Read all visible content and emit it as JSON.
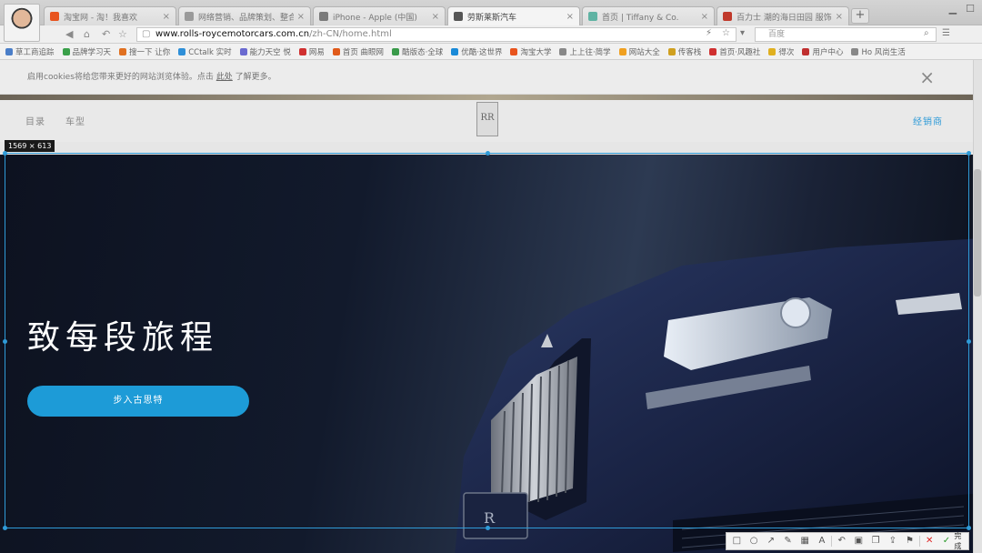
{
  "browser": {
    "tabs": [
      {
        "label": "淘宝网 - 淘！我喜欢",
        "color": "#e8541e",
        "active": false
      },
      {
        "label": "网络营销、品牌策划、整合营销",
        "color": "#9a9a9a",
        "active": false
      },
      {
        "label": "iPhone - Apple (中国)",
        "color": "#7a7a7a",
        "active": false
      },
      {
        "label": "劳斯莱斯汽车",
        "color": "#555555",
        "active": true
      },
      {
        "label": "首页 | Tiffany & Co.",
        "color": "#5fb3a3",
        "active": false
      },
      {
        "label": "百力士 潮的海日田园 服饰",
        "color": "#c0392b",
        "active": false
      }
    ],
    "tab_close": "×",
    "new_tab": "+",
    "url_host": "www.rolls-roycemotorcars.com.cn",
    "url_path": "/zh-CN/home.html",
    "search_placeholder": "百度"
  },
  "bookmarks": [
    {
      "label": "草工商追踪",
      "color": "#4a7ec8"
    },
    {
      "label": "品牌学习天",
      "color": "#3aa04a"
    },
    {
      "label": "搜一下 让你",
      "color": "#e07020"
    },
    {
      "label": "CCtalk 实时",
      "color": "#2f8fd8"
    },
    {
      "label": "能力天空 悦",
      "color": "#6a6ad0"
    },
    {
      "label": "网易",
      "color": "#d03030"
    },
    {
      "label": "首页 曲眼网",
      "color": "#e05a1a"
    },
    {
      "label": "酷版态·全球",
      "color": "#3a9a4a"
    },
    {
      "label": "优酷·这世界",
      "color": "#1a8ad8"
    },
    {
      "label": "淘宝大学",
      "color": "#e8541e"
    },
    {
      "label": "上上往·简学",
      "color": "#888888"
    },
    {
      "label": "网站大全",
      "color": "#f0a020"
    },
    {
      "label": "传客栈",
      "color": "#d0a020"
    },
    {
      "label": "首页·风趣社",
      "color": "#d03030"
    },
    {
      "label": "得次",
      "color": "#e0b020"
    },
    {
      "label": "用户中心",
      "color": "#c03030"
    },
    {
      "label": "Ho 风尚生活",
      "color": "#888888"
    }
  ],
  "page": {
    "cookie_text": "启用cookies将给您带来更好的网站浏览体验。点击",
    "cookie_link": "此处",
    "cookie_tail": "了解更多。",
    "cookie_close": "×",
    "nav_directory": "目录",
    "nav_models": "车型",
    "nav_dealer": "经销商",
    "logo_text": "RR",
    "hero_title": "致每段旅程",
    "hero_button": "步入古思特"
  },
  "capture": {
    "size_label": "1569 × 613",
    "done_label": "完成"
  }
}
